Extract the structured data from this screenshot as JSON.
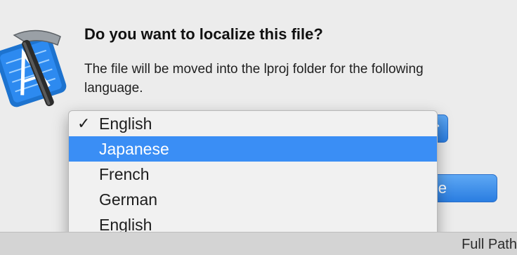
{
  "dialog": {
    "title": "Do you want to localize this file?",
    "message": "The file will be moved into the lproj folder for the following language.",
    "default_button_label": "lize",
    "popup_chevron": "⌃"
  },
  "menu": {
    "check_mark": "✓",
    "items": [
      {
        "label": "English",
        "checked": true,
        "highlighted": false
      },
      {
        "label": "Japanese",
        "checked": false,
        "highlighted": true
      },
      {
        "label": "French",
        "checked": false,
        "highlighted": false
      },
      {
        "label": "German",
        "checked": false,
        "highlighted": false
      },
      {
        "label": "English",
        "checked": false,
        "highlighted": false
      }
    ]
  },
  "background": {
    "path_label": "Full Path"
  },
  "colors": {
    "accent": "#3a8ef5",
    "dialog_bg": "#ececec"
  },
  "icons": {
    "app_icon": "xcode-icon"
  }
}
